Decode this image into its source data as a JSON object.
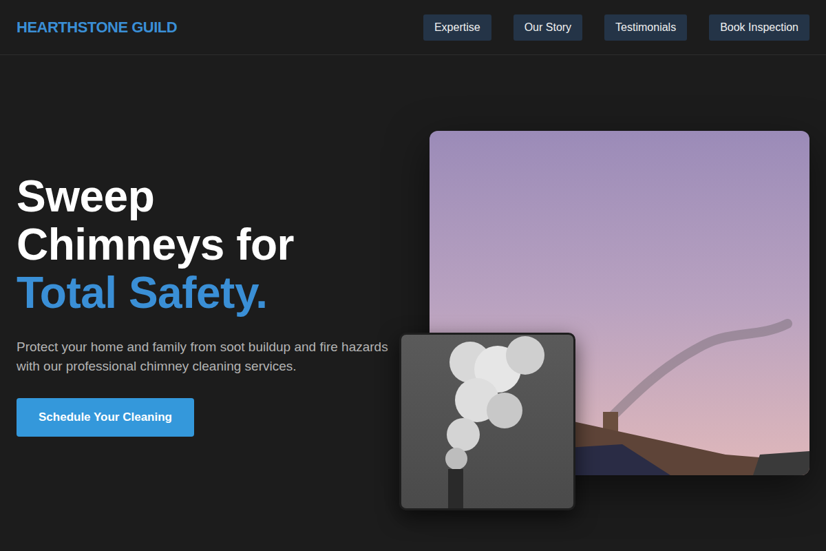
{
  "logo": "HEARTHSTONE GUILD",
  "nav": [
    "Expertise",
    "Our Story",
    "Testimonials",
    "Book Inspection"
  ],
  "hero": {
    "title_lines": [
      "Sweep",
      "Chimneys for"
    ],
    "highlight": "Total Safety.",
    "subtitle": "Protect your home and family from soot buildup and fire hazards with our professional chimney cleaning services.",
    "cta": "Schedule Your Cleaning"
  }
}
